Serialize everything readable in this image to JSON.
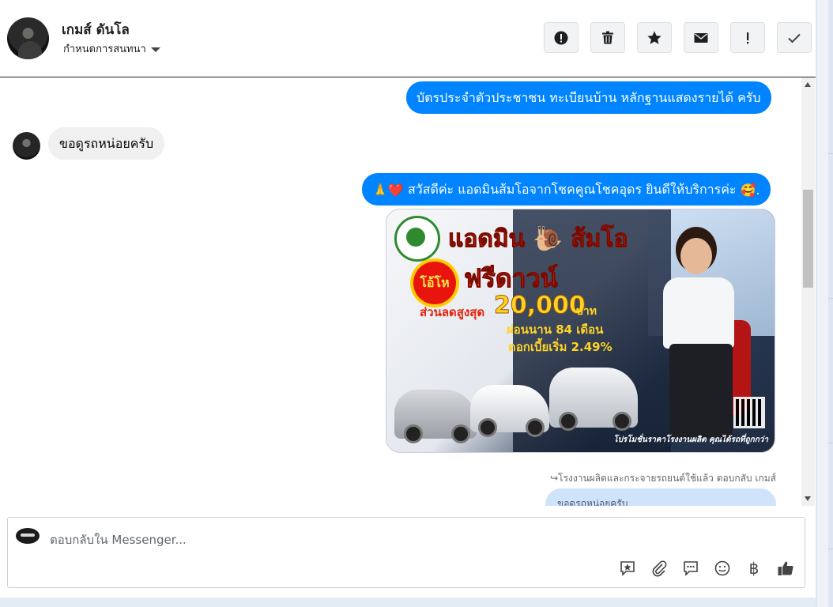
{
  "header": {
    "contact_name": "เกมส์ ดันโล",
    "assign_label": "กำหนดการสนทนา",
    "actions": [
      {
        "icon": "alert-circle-icon",
        "name": "mark-spam-button"
      },
      {
        "icon": "trash-icon",
        "name": "delete-button"
      },
      {
        "icon": "star-icon",
        "name": "follow-up-button"
      },
      {
        "icon": "mail-icon",
        "name": "mark-unread-button"
      },
      {
        "icon": "exclamation-icon",
        "name": "priority-button"
      },
      {
        "icon": "check-icon",
        "name": "mark-done-button"
      }
    ]
  },
  "messages": {
    "m1": "บัตรประจำตัวประชาชน ทะเบียนบ้าน หลักฐานแสดงรายได้ ครับ",
    "m2": "ขอดูรถหน่อยครับ",
    "m3_prefix_emoji": "🙏❤️",
    "m3": "สวัสดีค่ะ แอดมินส้มโอจากโชคคูณโชคอุดร ยินดีให้บริการค่ะ",
    "m3_suffix_emoji": "🥰.",
    "promo": {
      "title": "แอดมิน 🐌 ส้มโอ",
      "badge": "โอ้โห",
      "headline": "ฟรีดาวน์",
      "discount_label": "ส่วนลดสูงสุด",
      "discount_value": "20,000",
      "discount_unit": "บาท",
      "installment": "ผ่อนนาน 84 เดือน",
      "interest": "ดอกเบี้ยเริ่ม 2.49%",
      "footer": "โปรโมชั่นราคาโรงงานผลิต คุณได้รถที่ถูกกว่า"
    },
    "reply_meta": "โรงงานผลิตและกระจายรถยนต์ใช้แล้ว ตอบกลับ เกมส์",
    "quoted": "ขอดูรถหน่อยครับ"
  },
  "composer": {
    "placeholder": "ตอบกลับใน Messenger...",
    "tools": [
      "saved-reply-icon",
      "attachment-icon",
      "chat-bubble-icon",
      "emoji-icon",
      "baht-icon",
      "like-icon"
    ],
    "baht_symbol": "฿"
  }
}
